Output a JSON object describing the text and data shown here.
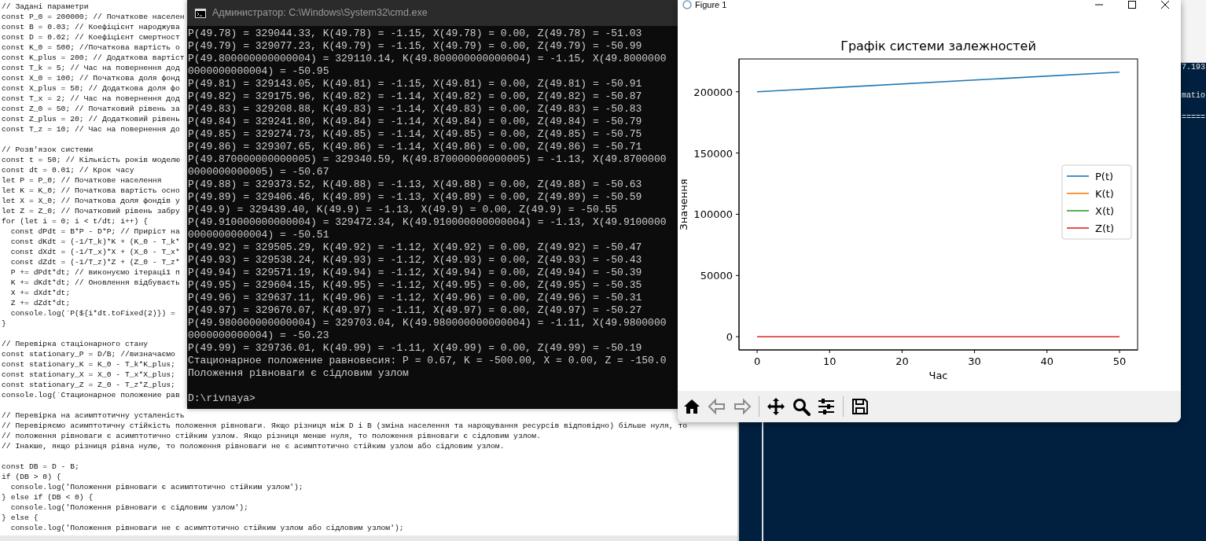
{
  "editor": {
    "code_blocks": [
      [
        "// Задані параметри",
        "const P_0 = 200000; // Початкове населен",
        "const B = 0.03; // Коефіцієнт народжува",
        "const D = 0.02; // Коефіцієнт смертност",
        "const K_0 = 500; //Початкова вартість о",
        "const K_plus = 200; // Додаткова вартіст",
        "const T_k = 5; // Час на повернення дод",
        "const X_0 = 100; // Початкова доля фонд",
        "const X_plus = 50; // Додаткова доля фо",
        "const T_x = 2; // Час на повернення дод",
        "const Z_0 = 50; // Початковий рівень за",
        "const Z_plus = 20; // Додатковий рівень",
        "const T_z = 10; // Час на повернення до"
      ],
      [
        "// Розв'язок системи",
        "const t = 50; // Кількість років моделю",
        "const dt = 0.01; // Крок часу",
        "let P = P_0; // Початкове населення",
        "let K = K_0; // Початкова вартість осно",
        "let X = X_0; // Початкова доля фондів у",
        "let Z = Z_0; // Початковий рівень забру",
        "for (let i = 0; i < t/dt; i++) {",
        "  const dPdt = B*P - D*P; // Приріст на",
        "  const dKdt = (-1/T_k)*K + (K_0 - T_k*",
        "  const dXdt = (-1/T_x)*X + (X_0 - T_x*",
        "  const dZdt = (-1/T_z)*Z + (Z_0 - T_z*",
        "  P += dPdt*dt; // виконуємо ітерації п",
        "  K += dKdt*dt; // Оновлення відбуваєть",
        "  X += dXdt*dt;",
        "  Z += dZdt*dt;",
        "  console.log(`P(${i*dt.toFixed(2)}) =",
        "}"
      ],
      [
        "// Перевірка стаціонарного стану",
        "const stationary_P = D/B; //визначаємо",
        "const stationary_K = K_0 - T_k*K_plus;",
        "const stationary_X = X_0 - T_x*X_plus;",
        "const stationary_Z = Z_0 - T_z*Z_plus;",
        "console.log(`Стационарное положение рав"
      ],
      [
        "// Перевірка на асимптотичну усталеність",
        "// Перевіряємо асимптотичну стійкість положення рівноваги. Якщо різниця між D і B (зміна населення та нарощування ресурсів відповідно) більше нуля, то",
        "// положення рівноваги є асимптотично стійким узлом. Якщо різниця менше нуля, то положення рівноваги є сідловим узлом.",
        "// Інакше, якщо різниця рівна нулю, то положення рівноваги не є асимптотично стійким узлом або сідловим узлом."
      ],
      [
        "const DB = D - B;",
        "if (DB > 0) {",
        "  console.log('Положення рівноваги є асимптотично стійким узлом');",
        "} else if (DB < 0) {",
        "  console.log('Положення рівноваги є сідловим узлом');",
        "} else {",
        "  console.log('Положення рівноваги не є асимптотично стійким узлом або сідловим узлом');"
      ]
    ]
  },
  "console": {
    "title": "Администратор: C:\\Windows\\System32\\cmd.exe",
    "lines": [
      "P(49.78) = 329044.33, K(49.78) = -1.15, X(49.78) = 0.00, Z(49.78) = -51.03",
      "P(49.79) = 329077.23, K(49.79) = -1.15, X(49.79) = 0.00, Z(49.79) = -50.99",
      "P(49.800000000000004) = 329110.14, K(49.800000000000004) = -1.15, X(49.8000000",
      "0000000000004) = -50.95",
      "P(49.81) = 329143.05, K(49.81) = -1.15, X(49.81) = 0.00, Z(49.81) = -50.91",
      "P(49.82) = 329175.96, K(49.82) = -1.14, X(49.82) = 0.00, Z(49.82) = -50.87",
      "P(49.83) = 329208.88, K(49.83) = -1.14, X(49.83) = 0.00, Z(49.83) = -50.83",
      "P(49.84) = 329241.80, K(49.84) = -1.14, X(49.84) = 0.00, Z(49.84) = -50.79",
      "P(49.85) = 329274.73, K(49.85) = -1.14, X(49.85) = 0.00, Z(49.85) = -50.75",
      "P(49.86) = 329307.65, K(49.86) = -1.14, X(49.86) = 0.00, Z(49.86) = -50.71",
      "P(49.870000000000005) = 329340.59, K(49.870000000000005) = -1.13, X(49.8700000",
      "0000000000005) = -50.67",
      "P(49.88) = 329373.52, K(49.88) = -1.13, X(49.88) = 0.00, Z(49.88) = -50.63",
      "P(49.89) = 329406.46, K(49.89) = -1.13, X(49.89) = 0.00, Z(49.89) = -50.59",
      "P(49.9) = 329439.40, K(49.9) = -1.13, X(49.9) = 0.00, Z(49.9) = -50.55",
      "P(49.910000000000004) = 329472.34, K(49.910000000000004) = -1.13, X(49.9100000",
      "0000000000004) = -50.51",
      "P(49.92) = 329505.29, K(49.92) = -1.12, X(49.92) = 0.00, Z(49.92) = -50.47",
      "P(49.93) = 329538.24, K(49.93) = -1.12, X(49.93) = 0.00, Z(49.93) = -50.43",
      "P(49.94) = 329571.19, K(49.94) = -1.12, X(49.94) = 0.00, Z(49.94) = -50.39",
      "P(49.95) = 329604.15, K(49.95) = -1.12, X(49.95) = 0.00, Z(49.95) = -50.35",
      "P(49.96) = 329637.11, K(49.96) = -1.12, X(49.96) = 0.00, Z(49.96) = -50.31",
      "P(49.97) = 329670.07, K(49.97) = -1.11, X(49.97) = 0.00, Z(49.97) = -50.27",
      "P(49.980000000000004) = 329703.04, K(49.980000000000004) = -1.11, X(49.9800000",
      "0000000000004) = -50.23",
      "P(49.99) = 329736.01, K(49.99) = -1.11, X(49.99) = 0.00, Z(49.99) = -50.19",
      "Стационарное положение равновесия: P = 0.67, K = -500.00, X = 0.00, Z = -150.0",
      "Положення рівноваги є сідловим узлом"
    ],
    "prompt": "D:\\rivnaya>"
  },
  "figure": {
    "title": "Figure 1",
    "toolbar": [
      {
        "kind": "home",
        "disabled": false
      },
      {
        "kind": "back",
        "disabled": true
      },
      {
        "kind": "forward",
        "disabled": true
      },
      {
        "kind": "pan",
        "disabled": false
      },
      {
        "kind": "zoom",
        "disabled": false
      },
      {
        "kind": "configure",
        "disabled": false
      },
      {
        "kind": "save",
        "disabled": false
      }
    ],
    "chart_data": {
      "type": "line",
      "title": "Графік системи залежностей",
      "xlabel": "Час",
      "ylabel": "Значення",
      "x": [
        0,
        50
      ],
      "series": [
        {
          "name": "P(t)",
          "color": "#1f77b4",
          "values": [
            200000,
            216000
          ]
        },
        {
          "name": "K(t)",
          "color": "#ff7f0e",
          "values": [
            null,
            null
          ]
        },
        {
          "name": "X(t)",
          "color": "#2ca02c",
          "values": [
            null,
            null
          ]
        },
        {
          "name": "Z(t)",
          "color": "#d62728",
          "values": [
            0,
            0
          ]
        }
      ],
      "legend": "center right",
      "xlim": [
        -2.5,
        52.5
      ],
      "ylim": [
        -10800,
        226800
      ],
      "xticks": [
        0,
        10,
        20,
        30,
        40,
        50
      ],
      "yticks": [
        0,
        50000,
        100000,
        150000,
        200000
      ]
    }
  },
  "background_terminal": {
    "lines": [
      "7.193",
      "matio",
      "====="
    ]
  }
}
